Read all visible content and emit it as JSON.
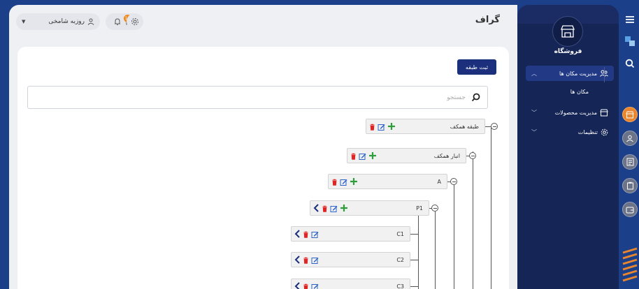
{
  "header": {
    "page_title": "گراف",
    "user_name": "روزبه شامخی",
    "notification_count": "10"
  },
  "toolbar": {
    "submit_label": "ثبت طبقه"
  },
  "search": {
    "placeholder": "جستجو"
  },
  "tree": {
    "nodes": [
      {
        "label": "طبقه همکف"
      },
      {
        "label": "انبار همکف"
      },
      {
        "label": "A"
      },
      {
        "label": "P1"
      },
      {
        "label": "C1"
      },
      {
        "label": "C2"
      },
      {
        "label": "C3"
      }
    ]
  },
  "sidebar": {
    "store_name": "فروشگاه",
    "items": [
      {
        "label": "مدیریت مکان ها"
      },
      {
        "label": "مکان ها"
      },
      {
        "label": "مدیریت محصولات"
      },
      {
        "label": "تنظیمات"
      }
    ]
  },
  "colors": {
    "primary": "#1b2f7c",
    "sidebar": "#152556",
    "accent_orange": "#e8862d",
    "add_green": "#2e9e3c",
    "delete_red": "#e02424",
    "edit_blue": "#2b63c8"
  },
  "icons": [
    "menu-icon",
    "translate-icon",
    "search-icon",
    "store-icon",
    "users-icon",
    "bell-icon",
    "mail-icon",
    "gear-icon",
    "trash-icon",
    "edit-icon",
    "plus-icon",
    "chevron-left-icon"
  ]
}
